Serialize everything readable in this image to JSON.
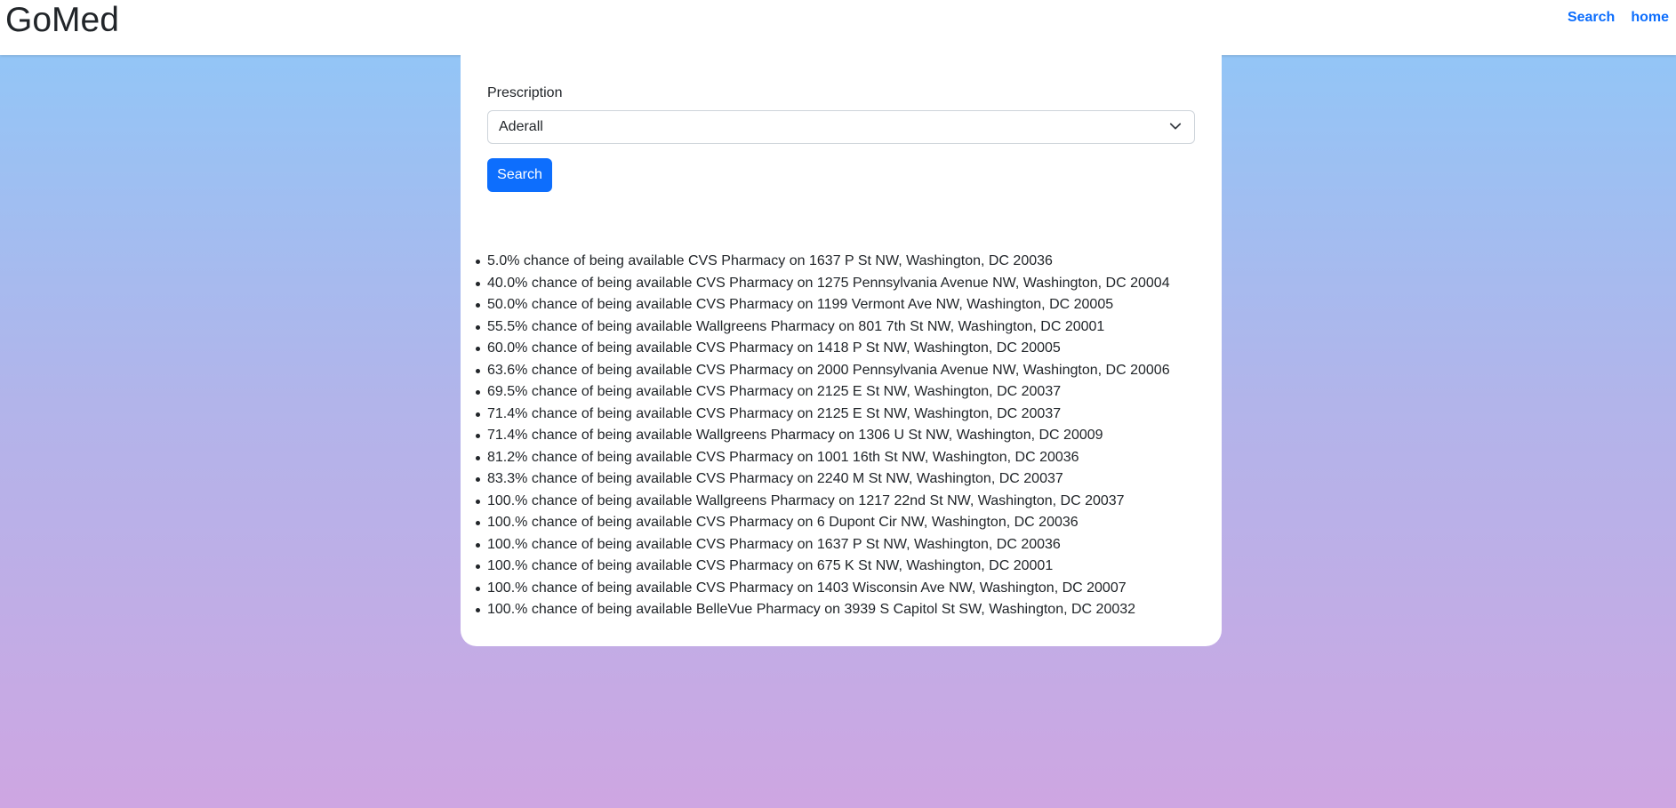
{
  "brand": "GoMed",
  "nav": {
    "search_label": "Search",
    "home_label": "home"
  },
  "form": {
    "label": "Prescription",
    "selected_value": "Aderall",
    "search_button": "Search"
  },
  "results": [
    "5.0% chance of being available CVS Pharmacy on 1637 P St NW, Washington, DC 20036",
    "40.0% chance of being available CVS Pharmacy on 1275 Pennsylvania Avenue NW, Washington, DC 20004",
    "50.0% chance of being available CVS Pharmacy on 1199 Vermont Ave NW, Washington, DC 20005",
    "55.5% chance of being available Wallgreens Pharmacy on 801 7th St NW, Washington, DC 20001",
    "60.0% chance of being available CVS Pharmacy on 1418 P St NW, Washington, DC 20005",
    "63.6% chance of being available CVS Pharmacy on 2000 Pennsylvania Avenue NW, Washington, DC 20006",
    "69.5% chance of being available CVS Pharmacy on 2125 E St NW, Washington, DC 20037",
    "71.4% chance of being available CVS Pharmacy on 2125 E St NW, Washington, DC 20037",
    "71.4% chance of being available Wallgreens Pharmacy on 1306 U St NW, Washington, DC 20009",
    "81.2% chance of being available CVS Pharmacy on 1001 16th St NW, Washington, DC 20036",
    "83.3% chance of being available CVS Pharmacy on 2240 M St NW, Washington, DC 20037",
    "100.% chance of being available Wallgreens Pharmacy on 1217 22nd St NW, Washington, DC 20037",
    "100.% chance of being available CVS Pharmacy on 6 Dupont Cir NW, Washington, DC 20036",
    "100.% chance of being available CVS Pharmacy on 1637 P St NW, Washington, DC 20036",
    "100.% chance of being available CVS Pharmacy on 675 K St NW, Washington, DC 20001",
    "100.% chance of being available CVS Pharmacy on 1403 Wisconsin Ave NW, Washington, DC 20007",
    "100.% chance of being available BelleVue Pharmacy on 3939 S Capitol St SW, Washington, DC 20032"
  ]
}
